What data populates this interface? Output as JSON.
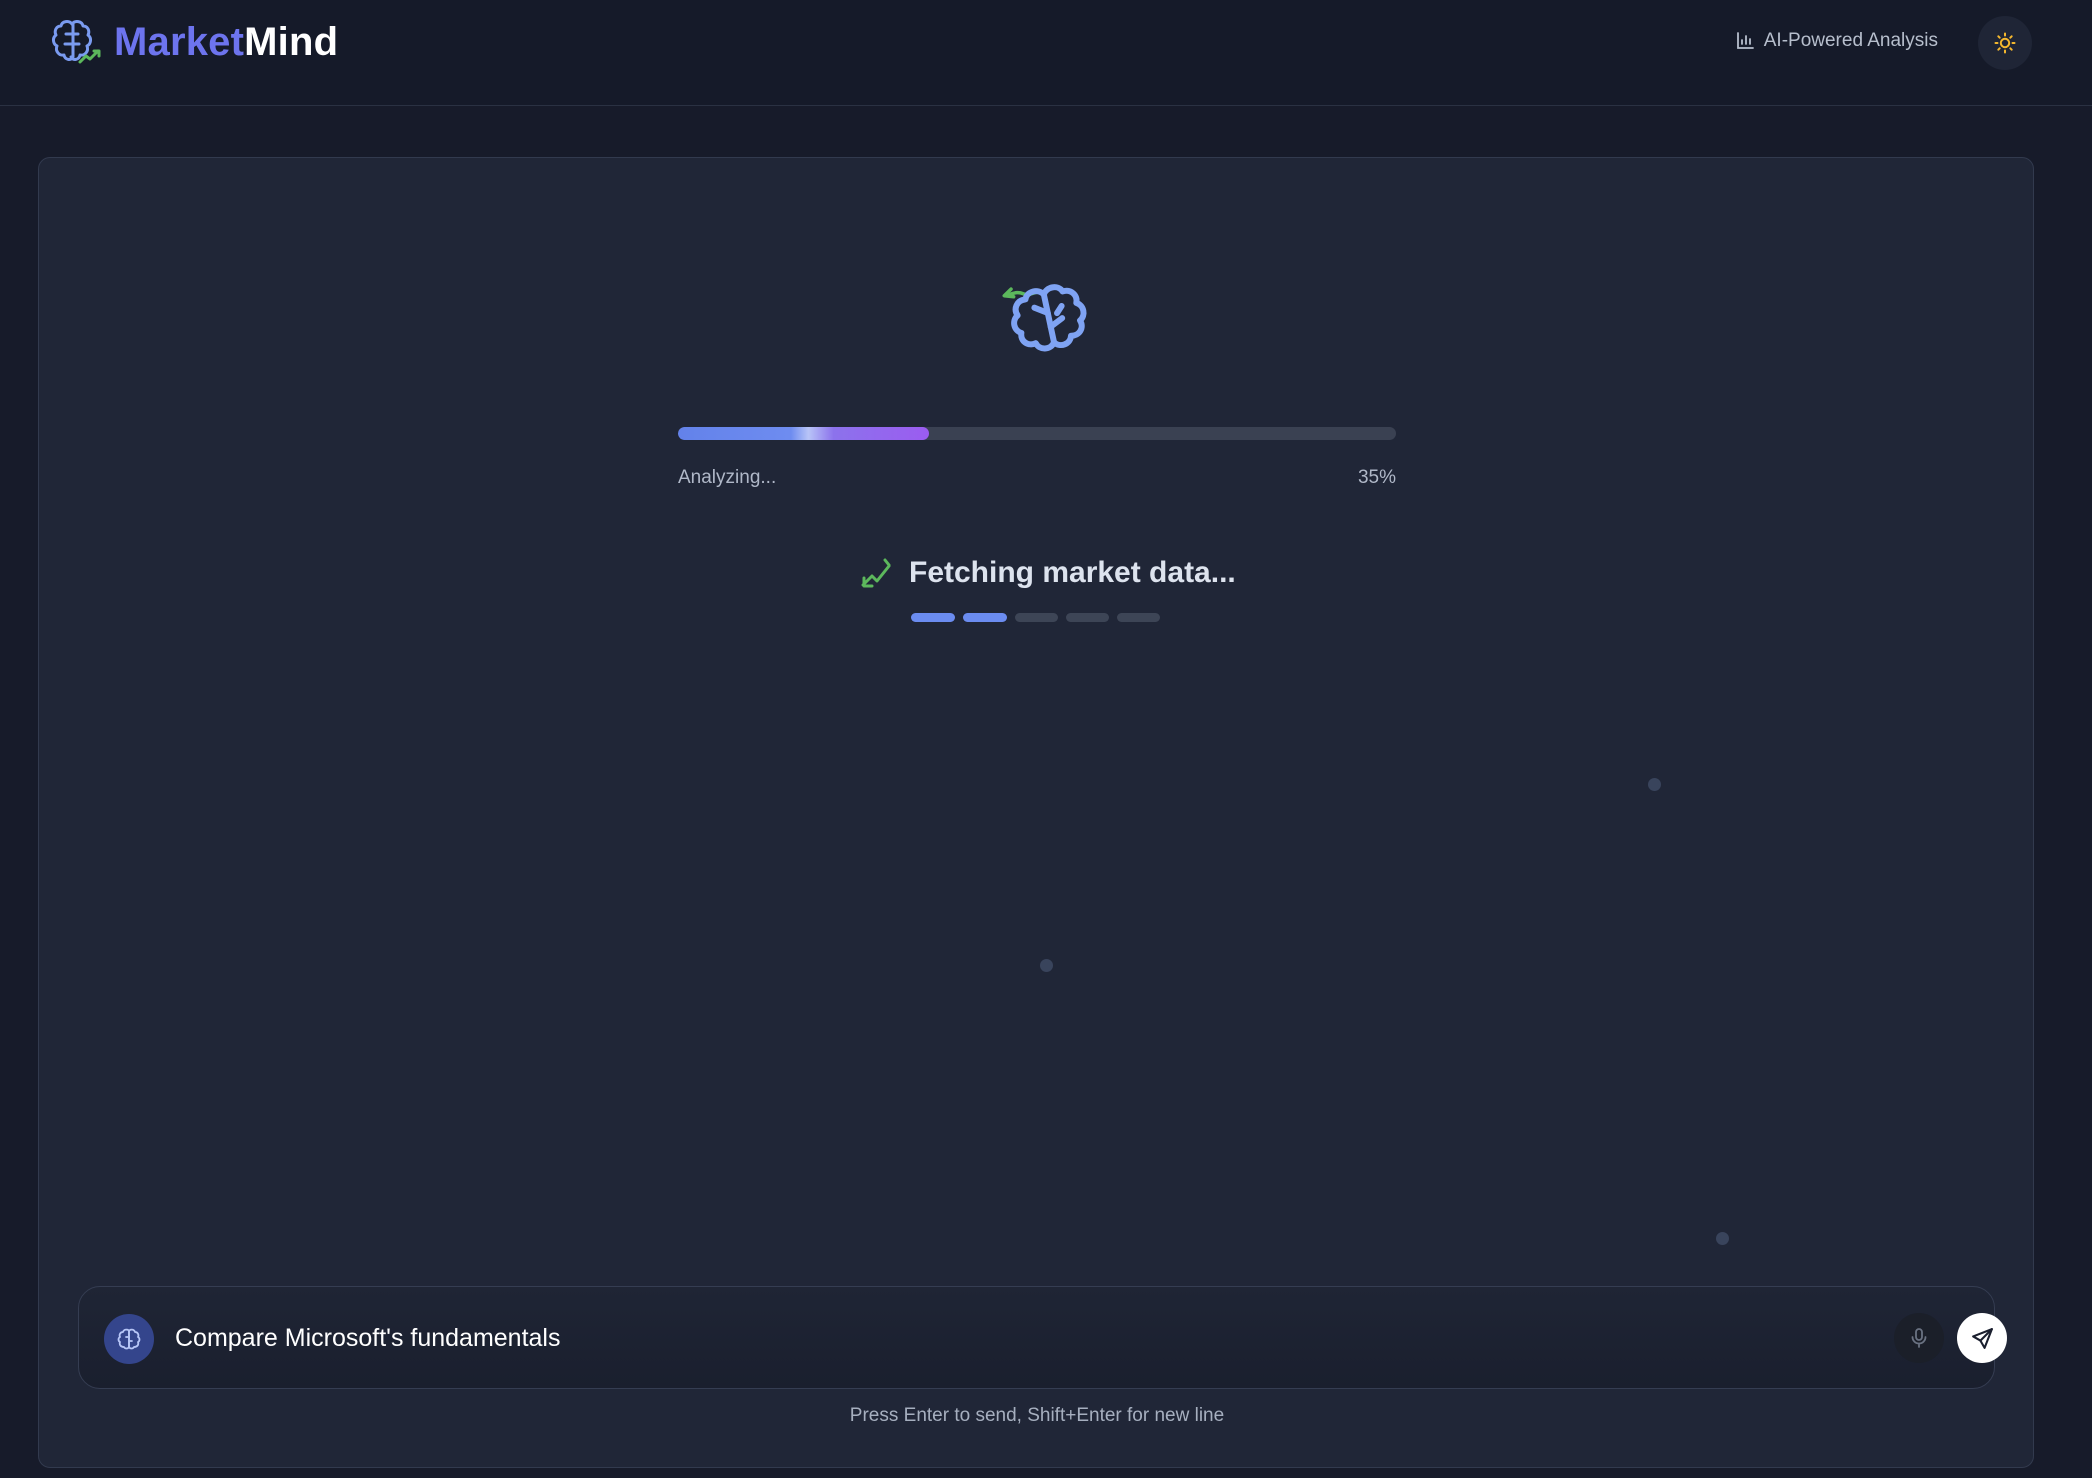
{
  "header": {
    "logo_part1": "Market",
    "logo_part2": "Mind",
    "badge_label": "AI-Powered Analysis",
    "badge_icon": "bar-chart-icon",
    "theme_icon": "sun-icon"
  },
  "loader": {
    "icon": "brain-icon",
    "progress_label": "Analyzing...",
    "progress_percent_text": "35%",
    "progress_value": 0.35,
    "status_icon": "trend-up-icon",
    "status_text": "Fetching market data...",
    "steps_total": 5,
    "steps_active": 2
  },
  "chat": {
    "avatar_icon": "brain-icon",
    "input_value": "Compare Microsoft's fundamentals",
    "mic_icon": "microphone-icon",
    "send_icon": "send-icon",
    "hint": "Press Enter to send, Shift+Enter for new line"
  },
  "colors": {
    "brand_primary": "#6d74ee",
    "accent_blue": "#6b8cf0",
    "accent_green": "#5cb85c",
    "sun_yellow": "#f5b82e"
  }
}
